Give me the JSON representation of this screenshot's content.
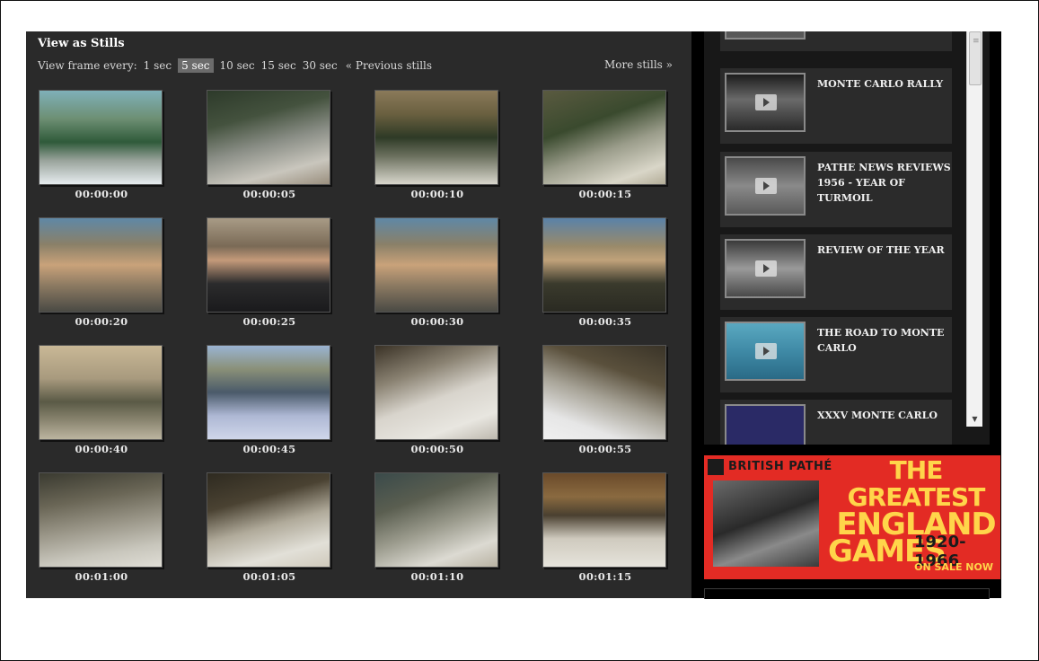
{
  "stills": {
    "title": "View as Stills",
    "interval_label": "View frame every:",
    "intervals": [
      "1 sec",
      "5 sec",
      "10 sec",
      "15 sec",
      "30 sec"
    ],
    "selected_interval": "5 sec",
    "prev_label": "« Previous stills",
    "more_label": "More stills »",
    "timecodes": [
      "00:00:00",
      "00:00:05",
      "00:00:10",
      "00:00:15",
      "00:00:20",
      "00:00:25",
      "00:00:30",
      "00:00:35",
      "00:00:40",
      "00:00:45",
      "00:00:50",
      "00:00:55",
      "00:01:00",
      "00:01:05",
      "00:01:10",
      "00:01:15"
    ]
  },
  "related": {
    "items": [
      {
        "title": "MONTE CARLO RALLY"
      },
      {
        "title": "PATHE NEWS REVIEWS 1956 - YEAR OF TURMOIL"
      },
      {
        "title": "REVIEW OF THE YEAR"
      },
      {
        "title": "THE ROAD TO MONTE CARLO"
      },
      {
        "title": "XXXV MONTE CARLO"
      }
    ]
  },
  "ad": {
    "brand": "BRITISH PATHÉ",
    "headline_1": "THE GREATEST",
    "headline_2": "ENGLAND",
    "headline_3": "GAMES",
    "years": "1920-1966",
    "cta": "ON SALE NOW"
  },
  "colors": {
    "panel_bg": "#2a2a2a",
    "selected_interval_bg": "#6b6b6b",
    "ad_red": "#e32b24",
    "ad_yellow": "#ffd54a"
  }
}
